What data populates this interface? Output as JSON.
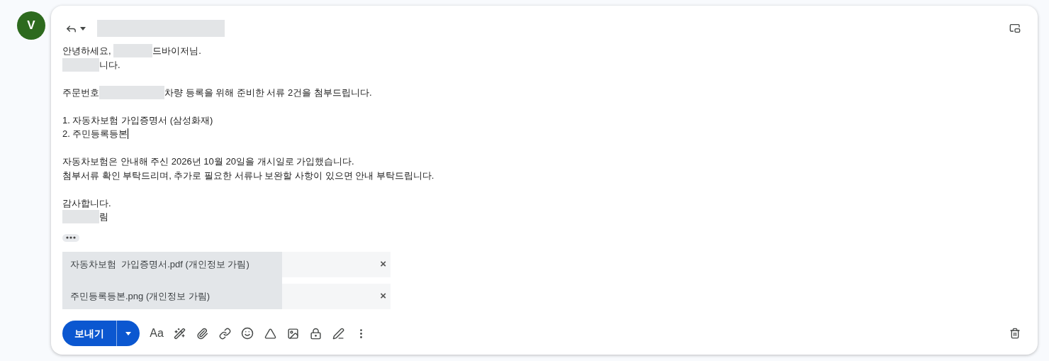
{
  "avatar": {
    "letter": "V"
  },
  "body": [
    [
      [
        {
          "kind": "text",
          "text": "안녕하세요, "
        },
        {
          "kind": "redacted"
        },
        {
          "kind": "text",
          "text": "드바이저님."
        }
      ],
      [
        {
          "kind": "redacted"
        },
        {
          "kind": "text",
          "text": "니다."
        }
      ]
    ],
    [
      [
        {
          "kind": "text",
          "text": "주문번호"
        },
        {
          "kind": "redacted"
        },
        {
          "kind": "text",
          "text": "차량 등록을 위해 준비한 서류 2건을 첨부드립니다."
        }
      ]
    ],
    [
      [
        {
          "kind": "text",
          "text": "1. 자동차보험 가입증명서 (삼성화재)"
        }
      ],
      [
        {
          "kind": "text",
          "text": "2. 주민등록등본"
        },
        {
          "kind": "cursor"
        }
      ]
    ],
    [
      [
        {
          "kind": "text",
          "text": "자동차보험은 안내해 주신 2026년 10월 20일을 개시일로 가입했습니다."
        }
      ],
      [
        {
          "kind": "text",
          "text": "첨부서류 확인 부탁드리며, 추가로 필요한 서류나 보완할 사항이 있으면 안내 부탁드립니다."
        }
      ]
    ],
    [
      [
        {
          "kind": "text",
          "text": "감사합니다."
        }
      ],
      [
        {
          "kind": "redacted"
        },
        {
          "kind": "text",
          "text": "림"
        }
      ]
    ]
  ],
  "attachments": [
    {
      "name": "자동차보험  가입증명서.pdf (개인정보 가림)",
      "remove": "×"
    },
    {
      "name": "주민등록등본.png (개인정보 가림)",
      "remove": "×"
    }
  ],
  "toolbar": {
    "send": "보내기",
    "format": "Aa"
  }
}
